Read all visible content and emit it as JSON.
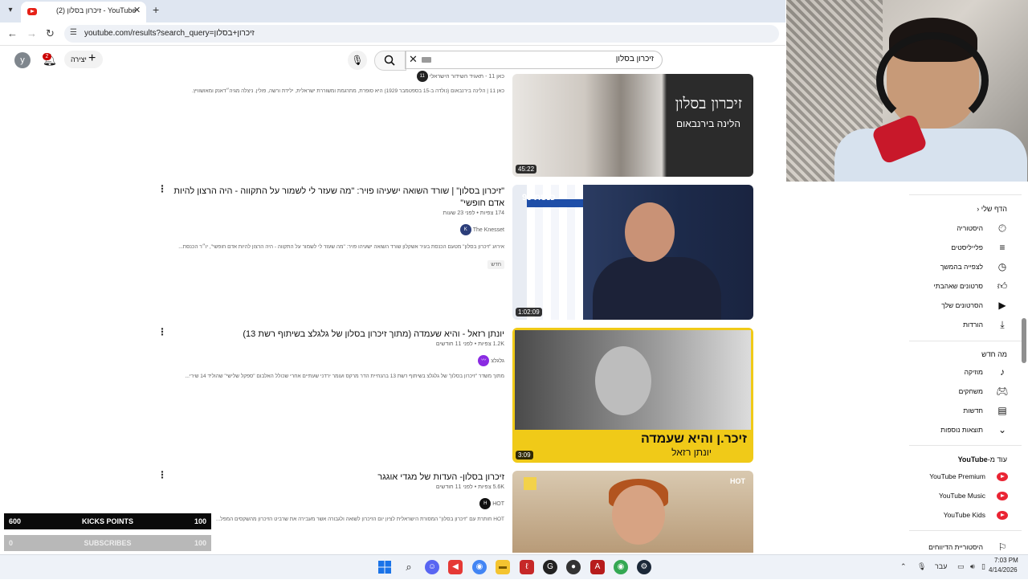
{
  "browser": {
    "tab_title": "(2) זיכרון בסלון - YouTube",
    "url": "youtube.com/results?search_query=זיכרון+בסלון"
  },
  "header": {
    "avatar_letter": "y",
    "notifications_count": "2",
    "create_label": "יצירה",
    "search_value": "זיכרון בסלון"
  },
  "results": [
    {
      "channel": "כאן 11 - תאגיד השידור הישראלי",
      "description": "כאן 11 | הלינה בירנבאום (נולדה ב-15 בספטמבר 1929) היא סופרת, מתרגמת ומשוררת ישראלית, ילידת ורשה, פולין. ניצלה מגיה״דאנק ומאושוויץ.",
      "duration": "45:22",
      "thumb_text_1": "זיכרון בסלון",
      "thumb_text_2": "הלינה בירנבאום"
    },
    {
      "title": "\"זיכרון בסלון\" | שורד השואה ישעיהו פויר: \"מה שעזר לי לשמור על התקווה - היה הרצון להיות אדם חופשי\"",
      "meta": "174 צפיות • לפני 23 שעות",
      "channel": "The Knesset",
      "description": "אירוע \"זיכרון בסלון\" מטעם הכנסת בעיר אשקלון שורד השואה ישעיהו פויר: \"מה שעזר לי לשמור על התקווה - היה הרצון להיות אדם חופשי\", יו״ר הכנסת...",
      "badge": "חדש",
      "duration": "1:02:09",
      "thumb_logo": "כנסת 99"
    },
    {
      "title": "יונתן רזאל - והיא שעמדה (מתוך זיכרון בסלון של גלגלצ בשיתוף רשת 13)",
      "meta": "1.2K צפיות • לפני 11 חודשים",
      "channel": "גלגלצ",
      "description": "מתוך משדר \"זיכרון בסלון\" של גלגלצ בשיתוף רשת 13 בהנחיית הדר מרקס ועומר ירדני שעתיים אחרי שכולל האלבום \"ספקל שלישי\" שהוליד 14 שירי...",
      "duration": "3:09",
      "thumb_text_1": "זיכר.ן והיא שעמדה",
      "thumb_text_2": "יונתן רזאל"
    },
    {
      "title": "זיכרון בסלון- העדות של מגדי אוגגר",
      "meta": "5.6K צפיות • לפני 11 חודשים",
      "channel": "HOT",
      "description": "HOT חותרת עם \"זיכרון בסלון\" המסורת הישראלית לציון יום הזיכרון לשואה ולגבורה אשר מעבירה את שרביט הזיכרון מהשקסים המפל...",
      "thumb_logo": "HOT"
    }
  ],
  "guide": {
    "you_header": "הדף שלי",
    "you_items": [
      "היסטוריה",
      "פלייליסטים",
      "לצפייה בהמשך",
      "סרטונים שאהבתי",
      "הסרטונים שלך",
      "הורדות"
    ],
    "explore_header": "מה חדש",
    "explore_items": [
      "מוזיקה",
      "משחקים",
      "חדשות",
      "תוצאות נוספות"
    ],
    "more_header_prefix": "עוד מ-",
    "more_header_brand": "YouTube",
    "more_items": [
      "YouTube Premium",
      "YouTube Music",
      "YouTube Kids"
    ],
    "report_history": "היסטוריית הדיווחים"
  },
  "overlay": {
    "kicks": {
      "left": "600",
      "label": "KICKS POINTS",
      "right": "100"
    },
    "subs": {
      "left": "0",
      "label": "SUBSCRIBES",
      "right": "100"
    }
  },
  "taskbar": {
    "language": "עבר",
    "time": "7:03 PM",
    "date": "4/14/2026"
  },
  "colors": {
    "youtube_red": "#ff0000",
    "thumbnail_yellow": "#f0ca18"
  }
}
